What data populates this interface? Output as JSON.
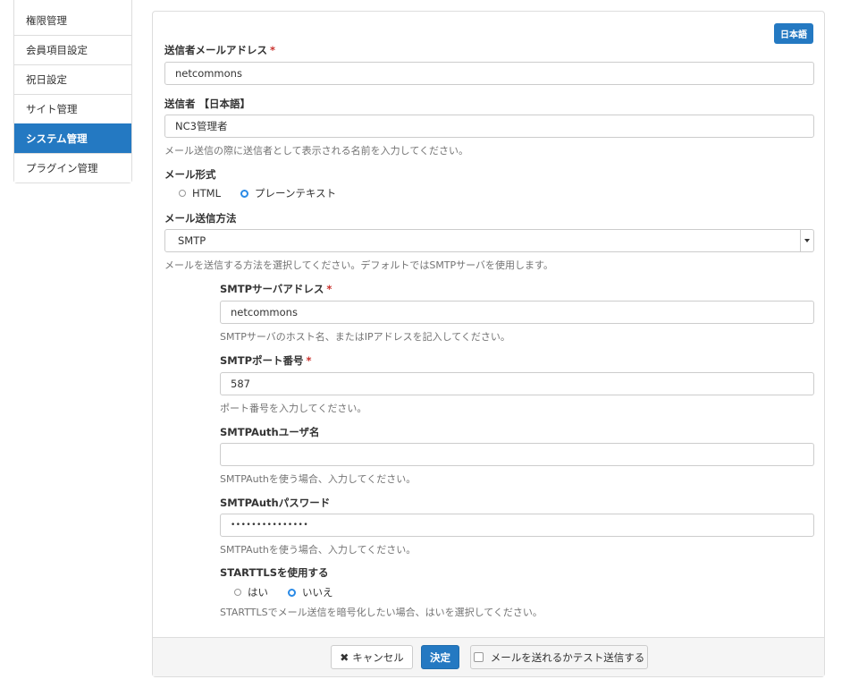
{
  "sidebar": {
    "items": [
      {
        "label": "権限管理",
        "active": false
      },
      {
        "label": "会員項目設定",
        "active": false
      },
      {
        "label": "祝日設定",
        "active": false
      },
      {
        "label": "サイト管理",
        "active": false
      },
      {
        "label": "システム管理",
        "active": true
      },
      {
        "label": "プラグイン管理",
        "active": false
      }
    ]
  },
  "form": {
    "language_badge": "日本語",
    "required_mark": "*",
    "sender_email": {
      "label": "送信者メールアドレス",
      "value": "netcommons"
    },
    "sender_name": {
      "label": "送信者 【日本語】",
      "value": "NC3管理者",
      "help": "メール送信の際に送信者として表示される名前を入力してください。"
    },
    "mail_format": {
      "label": "メール形式",
      "options": [
        "HTML",
        "プレーンテキスト"
      ],
      "selected": "プレーンテキスト"
    },
    "send_method": {
      "label": "メール送信方法",
      "value": "SMTP",
      "help": "メールを送信する方法を選択してください。デフォルトではSMTPサーバを使用します。"
    },
    "smtp_host": {
      "label": "SMTPサーバアドレス",
      "value": "netcommons",
      "help": "SMTPサーバのホスト名、またはIPアドレスを記入してください。"
    },
    "smtp_port": {
      "label": "SMTPポート番号",
      "value": "587",
      "help": "ポート番号を入力してください。"
    },
    "smtp_user": {
      "label": "SMTPAuthユーザ名",
      "value": "",
      "help": "SMTPAuthを使う場合、入力してください。"
    },
    "smtp_pass": {
      "label": "SMTPAuthパスワード",
      "value": "•••••••••••••••",
      "help": "SMTPAuthを使う場合、入力してください。"
    },
    "starttls": {
      "label": "STARTTLSを使用する",
      "options": [
        "はい",
        "いいえ"
      ],
      "selected": "いいえ",
      "help": "STARTTLSでメール送信を暗号化したい場合、はいを選択してください。"
    }
  },
  "footer": {
    "cancel_label": "キャンセル",
    "submit_label": "決定",
    "test_label": "メールを送れるかテスト送信する"
  }
}
